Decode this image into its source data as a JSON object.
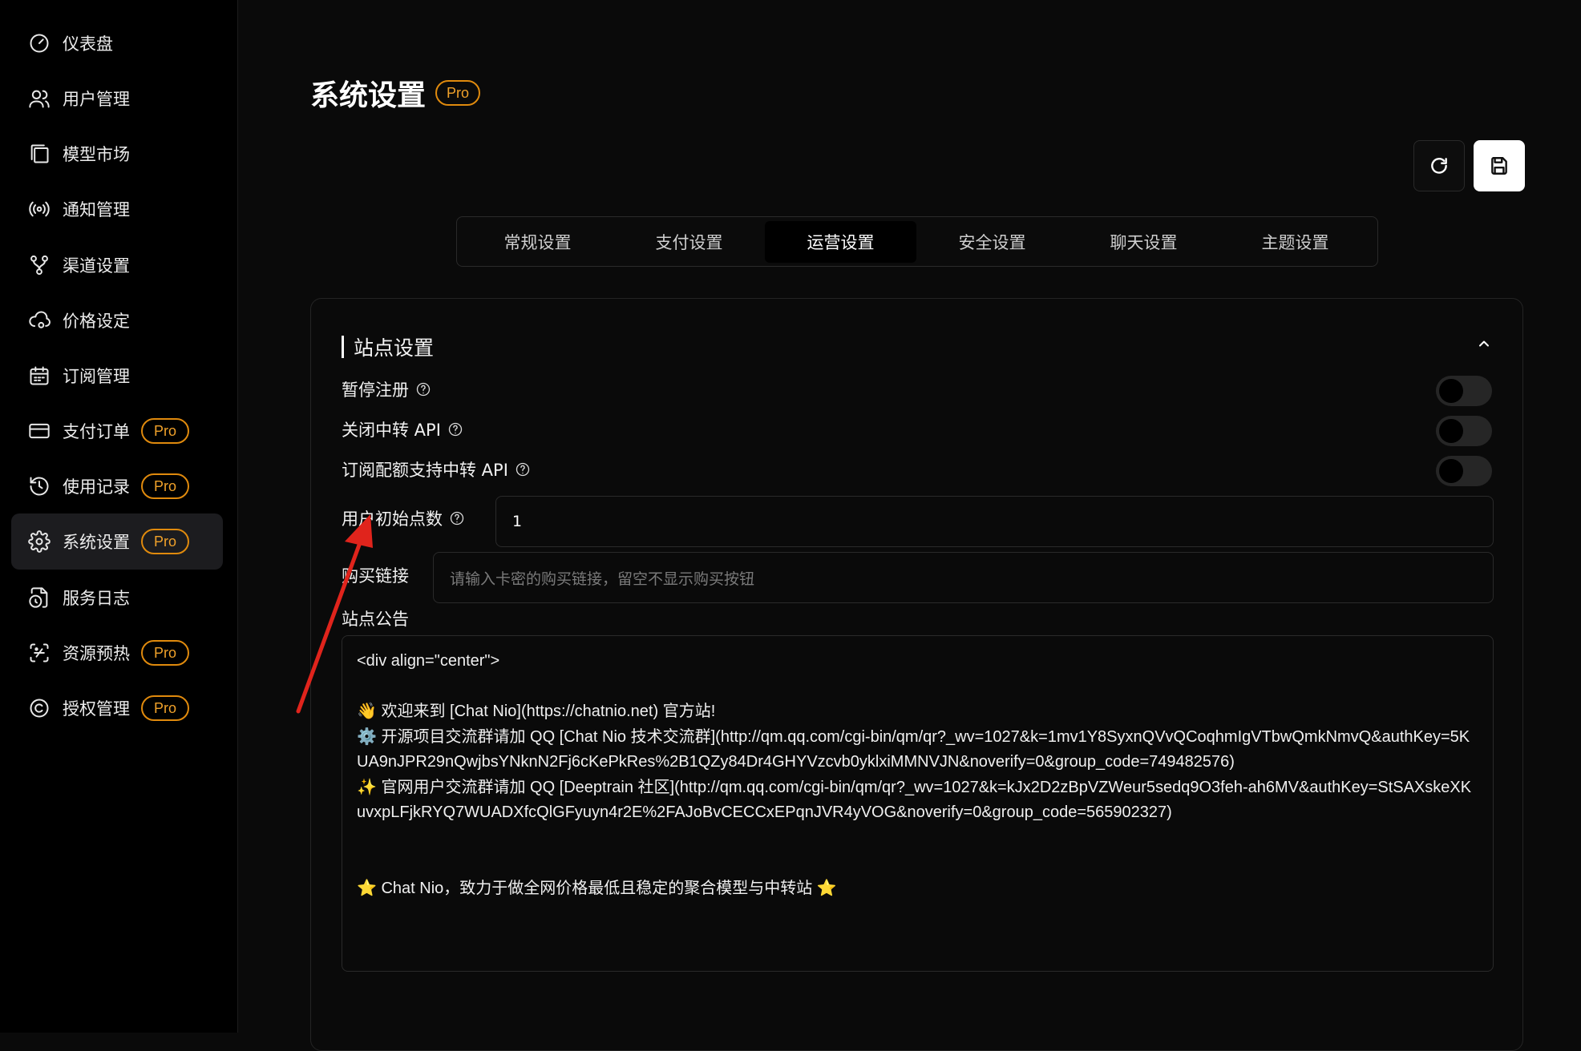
{
  "sidebar": {
    "items": [
      {
        "label": "仪表盘",
        "icon": "gauge-icon",
        "pro": ""
      },
      {
        "label": "用户管理",
        "icon": "users-icon",
        "pro": ""
      },
      {
        "label": "模型市场",
        "icon": "book-icon",
        "pro": ""
      },
      {
        "label": "通知管理",
        "icon": "broadcast-icon",
        "pro": ""
      },
      {
        "label": "渠道设置",
        "icon": "git-branch-icon",
        "pro": ""
      },
      {
        "label": "价格设定",
        "icon": "cloud-cog-icon",
        "pro": ""
      },
      {
        "label": "订阅管理",
        "icon": "calendar-icon",
        "pro": ""
      },
      {
        "label": "支付订单",
        "icon": "credit-card-icon",
        "pro": "Pro"
      },
      {
        "label": "使用记录",
        "icon": "history-icon",
        "pro": "Pro"
      },
      {
        "label": "系统设置",
        "icon": "gear-icon",
        "pro": "Pro",
        "active": true
      },
      {
        "label": "服务日志",
        "icon": "file-clock-icon",
        "pro": ""
      },
      {
        "label": "资源预热",
        "icon": "scan-icon",
        "pro": "Pro"
      },
      {
        "label": "授权管理",
        "icon": "copyright-icon",
        "pro": "Pro"
      }
    ]
  },
  "header": {
    "title": "系统设置",
    "badge": "Pro"
  },
  "tabs": [
    "常规设置",
    "支付设置",
    "运营设置",
    "安全设置",
    "聊天设置",
    "主题设置"
  ],
  "active_tab": "运营设置",
  "section": {
    "title": "站点设置",
    "toggles": [
      {
        "label": "暂停注册",
        "on": false
      },
      {
        "label": "关闭中转 API",
        "on": false
      },
      {
        "label": "订阅配额支持中转 API",
        "on": false
      }
    ],
    "initial_points": {
      "label": "用户初始点数",
      "value": "1"
    },
    "buy_link": {
      "label": "购买链接",
      "placeholder": "请输入卡密的购买链接，留空不显示购买按钮"
    },
    "announcement": {
      "label": "站点公告",
      "value": "<div align=\"center\">\n\n👋 欢迎来到 [Chat Nio](https://chatnio.net) 官方站!\n⚙️ 开源项目交流群请加 QQ [Chat Nio 技术交流群](http://qm.qq.com/cgi-bin/qm/qr?_wv=1027&k=1mv1Y8SyxnQVvQCoqhmIgVTbwQmkNmvQ&authKey=5KUA9nJPR29nQwjbsYNknN2Fj6cKePkRes%2B1QZy84Dr4GHYVzcvb0yklxiMMNVJN&noverify=0&group_code=749482576)\n✨ 官网用户交流群请加 QQ [Deeptrain 社区](http://qm.qq.com/cgi-bin/qm/qr?_wv=1027&k=kJx2D2zBpVZWeur5sedq9O3feh-ah6MV&authKey=StSAXskeXKuvxpLFjkRYQ7WUADXfcQlGFyuyn4r2E%2FAJoBvCECCxEPqnJVR4yVOG&noverify=0&group_code=565902327)\n\n\n⭐ Chat Nio，致力于做全网价格最低且稳定的聚合模型与中转站 ⭐"
    }
  },
  "colors": {
    "accent": "#e08a0d",
    "annotation_arrow": "#e0241c"
  }
}
